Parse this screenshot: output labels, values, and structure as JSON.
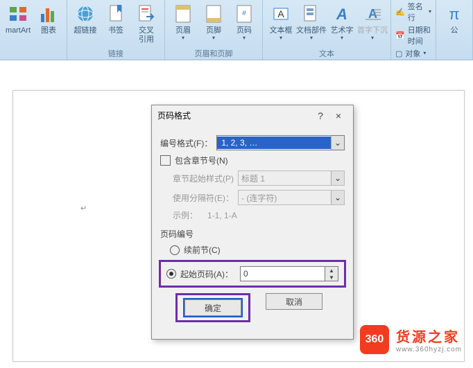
{
  "ribbon": {
    "groups": [
      {
        "title": "",
        "items": [
          {
            "label": "martArt"
          },
          {
            "label": "图表"
          }
        ]
      },
      {
        "title": "链接",
        "items": [
          {
            "label": "超链接"
          },
          {
            "label": "书签"
          },
          {
            "label": "交叉\n引用"
          }
        ]
      },
      {
        "title": "页眉和页脚",
        "items": [
          {
            "label": "页眉"
          },
          {
            "label": "页脚"
          },
          {
            "label": "页码"
          }
        ]
      },
      {
        "title": "文本",
        "items": [
          {
            "label": "文本框"
          },
          {
            "label": "文档部件"
          },
          {
            "label": "艺术字"
          },
          {
            "label": "首字下沉"
          }
        ]
      }
    ],
    "side_items": [
      {
        "label": "签名行"
      },
      {
        "label": "日期和时间"
      },
      {
        "label": "对象"
      }
    ],
    "omega_label": "公"
  },
  "dialog": {
    "title": "页码格式",
    "help": "?",
    "close": "×",
    "format_label": "编号格式(F)：",
    "format_value": "1, 2, 3, …",
    "include_chapter_label": "包含章节号(N)",
    "chapter_style_label": "章节起始样式(P)",
    "chapter_style_value": "标题 1",
    "separator_label": "使用分隔符(E)：",
    "separator_value": "-  (连字符)",
    "example_label": "示例：",
    "example_value": "1-1,  1-A",
    "pagenum_section": "页码编号",
    "continue_label": "续前节(C)",
    "start_label": "起始页码(A)：",
    "start_value": "0",
    "ok": "确定",
    "cancel": "取消"
  },
  "watermark": {
    "badge": "360",
    "title": "货源之家",
    "url": "www.360hyzj.com"
  }
}
